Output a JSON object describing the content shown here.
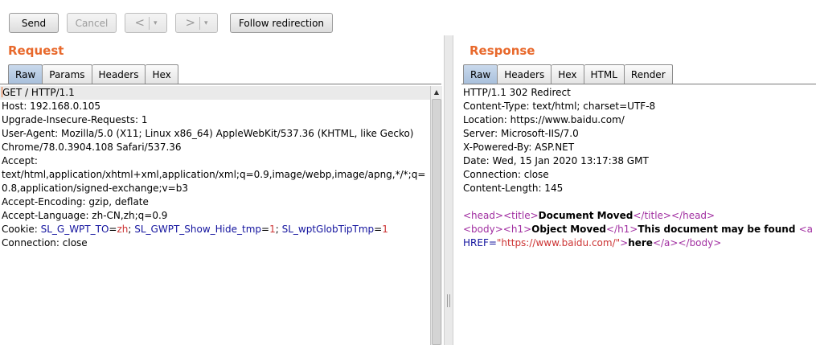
{
  "toolbar": {
    "send": "Send",
    "cancel": "Cancel",
    "back_glyph": "<",
    "forward_glyph": ">",
    "dropdown_glyph": "▾",
    "follow": "Follow redirection"
  },
  "request": {
    "title": "Request",
    "tabs": [
      "Raw",
      "Params",
      "Headers",
      "Hex"
    ],
    "lines": [
      "GET / HTTP/1.1",
      "Host: 192.168.0.105",
      "Upgrade-Insecure-Requests: 1",
      "User-Agent: Mozilla/5.0 (X11; Linux x86_64) AppleWebKit/537.36 (KHTML, like Gecko)",
      "Chrome/78.0.3904.108 Safari/537.36",
      "Accept:",
      "text/html,application/xhtml+xml,application/xml;q=0.9,image/webp,image/apng,*/*;q=",
      "0.8,application/signed-exchange;v=b3",
      "Accept-Encoding: gzip, deflate",
      "Accept-Language: zh-CN,zh;q=0.9"
    ],
    "cookie": {
      "label": "Cookie: ",
      "pairs": [
        {
          "name": "SL_G_WPT_TO",
          "eq": "=",
          "value": "zh",
          "sep": "; "
        },
        {
          "name": "SL_GWPT_Show_Hide_tmp",
          "eq": "=",
          "value": "1",
          "sep": "; "
        },
        {
          "name": "SL_wptGlobTipTmp",
          "eq": "=",
          "value": "1",
          "sep": ""
        }
      ]
    },
    "last_line": "Connection: close"
  },
  "response": {
    "title": "Response",
    "tabs": [
      "Raw",
      "Headers",
      "Hex",
      "HTML",
      "Render"
    ],
    "lines": [
      "HTTP/1.1 302 Redirect",
      "Content-Type: text/html; charset=UTF-8",
      "Location: https://www.baidu.com/",
      "Server: Microsoft-IIS/7.0",
      "X-Powered-By: ASP.NET",
      "Date: Wed, 15 Jan 2020 13:17:38 GMT",
      "Connection: close",
      "Content-Length: 145"
    ],
    "html": {
      "head_open": "<head>",
      "title_open": "<title>",
      "title_text": "Document Moved",
      "title_close": "</title>",
      "head_close": "</head>",
      "body_open": "<body>",
      "h1_open": "<h1>",
      "h1_text": "Object Moved",
      "h1_close": "</h1>",
      "body_text": "This document may be found ",
      "a_open": "<a",
      "href_attr": "HREF=",
      "href_value": "\"https://www.baidu.com/\"",
      "a_end": ">",
      "a_text": "here",
      "a_close": "</a>",
      "body_close": "</body>"
    }
  },
  "colors": {
    "accent": "#e8692c",
    "active_tab": "#b9cde6",
    "key_blue": "#13139e",
    "value_red": "#cc3333",
    "tag_purple": "#a12fa1"
  }
}
